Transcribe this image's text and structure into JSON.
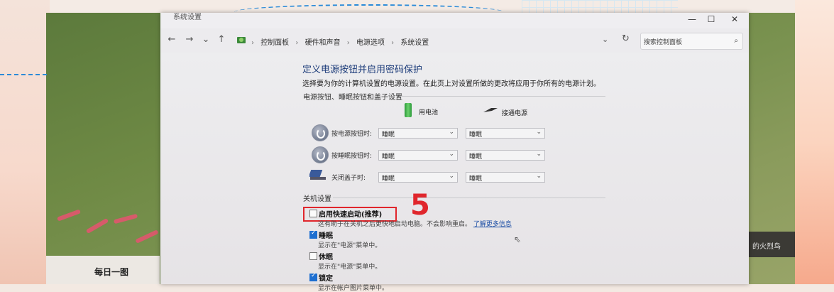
{
  "window": {
    "title": "系统设置",
    "controls": {
      "minimize": "—",
      "maximize": "☐",
      "close": "✕"
    }
  },
  "nav": {
    "back": "←",
    "forward": "→",
    "recent": "⌄",
    "up": "↑",
    "breadcrumbs": [
      "控制面板",
      "硬件和声音",
      "电源选项",
      "系统设置"
    ],
    "search_placeholder": "搜索控制面板"
  },
  "page": {
    "heading": "定义电源按钮并启用密码保护",
    "description": "选择要为你的计算机设置的电源设置。在此页上对设置所做的更改将应用于你所有的电源计划。"
  },
  "power_group": {
    "label": "电源按钮、睡眠按钮和盖子设置",
    "columns": [
      "用电池",
      "接通电源"
    ],
    "rows": [
      {
        "label": "按电源按钮时:",
        "battery": "睡眠",
        "plugged": "睡眠"
      },
      {
        "label": "按睡眠按钮时:",
        "battery": "睡眠",
        "plugged": "睡眠"
      },
      {
        "label": "关闭盖子时:",
        "battery": "睡眠",
        "plugged": "睡眠"
      }
    ]
  },
  "shutdown_group": {
    "label": "关机设置",
    "options": [
      {
        "label": "启用快速启动(推荐)",
        "checked": false,
        "desc": "这有助于在关机之后更快地启动电脑。不会影响重启。",
        "link": "了解更多信息"
      },
      {
        "label": "睡眠",
        "checked": true,
        "desc": "显示在\"电源\"菜单中。"
      },
      {
        "label": "休眠",
        "checked": false,
        "desc": "显示在\"电源\"菜单中。"
      },
      {
        "label": "锁定",
        "checked": true,
        "desc": "显示在帐户图片菜单中。"
      }
    ]
  },
  "annotation": {
    "step_number": "5",
    "color": "#e0262c"
  },
  "wallpaper": {
    "daily_label": "每日一图",
    "caption": "的火烈鸟"
  }
}
